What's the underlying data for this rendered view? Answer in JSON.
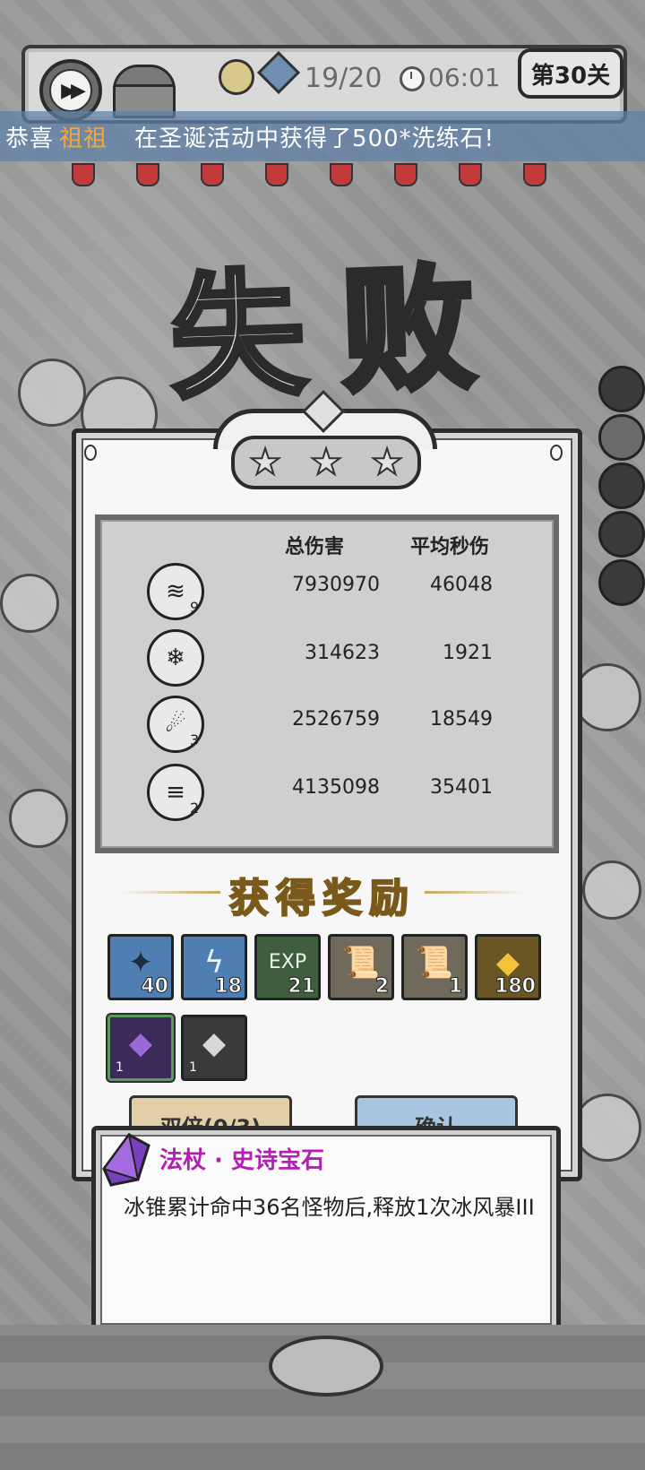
{
  "topbar": {
    "stage_count": "19/20",
    "timer": "06:01",
    "level_label": "第30关"
  },
  "banner": {
    "prefix": "恭喜",
    "player": "祖祖",
    "message": "在圣诞活动中获得了500*洗练石!"
  },
  "title": "失败",
  "stars": {
    "earned": 0,
    "total": 3
  },
  "damage": {
    "header_total": "总伤害",
    "header_dps": "平均秒伤",
    "rows": [
      {
        "icon": "claw-marks-icon",
        "level": "9",
        "total": "7930970",
        "dps": "46048"
      },
      {
        "icon": "frost-splash-icon",
        "level": "",
        "total": "314623",
        "dps": "1921"
      },
      {
        "icon": "meteor-icon",
        "level": "3",
        "total": "2526759",
        "dps": "18549"
      },
      {
        "icon": "tornado-icon",
        "level": "2",
        "total": "4135098",
        "dps": "35401"
      }
    ]
  },
  "rewards": {
    "title": "获得奖励",
    "items": [
      {
        "icon": "ice-shard-icon",
        "qty": "40"
      },
      {
        "icon": "lightning-crystal-icon",
        "qty": "18"
      },
      {
        "icon": "exp-orb-icon",
        "label": "EXP",
        "qty": "21"
      },
      {
        "icon": "scroll-hook-icon",
        "qty": "2"
      },
      {
        "icon": "scroll-boot-icon",
        "qty": "1"
      },
      {
        "icon": "gold-coin-icon",
        "qty": "180"
      },
      {
        "icon": "purple-gem-icon",
        "qty": "1"
      },
      {
        "icon": "silver-gem-icon",
        "qty": "1"
      }
    ]
  },
  "buttons": {
    "double": "双倍(0/3)",
    "confirm": "确认"
  },
  "tooltip": {
    "title": "法杖 · 史诗宝石",
    "description": "冰锥累计命中36名怪物后,释放1次冰风暴III"
  },
  "colors": {
    "banner_bg": "#5c80a8",
    "player_name": "#f4a63c",
    "epic_purple": "#b21fb2",
    "reward_gold": "#f3d68a"
  }
}
